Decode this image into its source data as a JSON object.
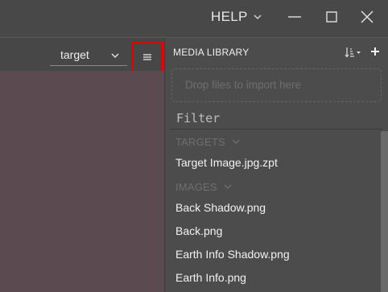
{
  "titlebar": {
    "help_label": "HELP",
    "help_chevron_icon": "chevron-down-icon",
    "minimize_icon": "minimize-icon",
    "maximize_icon": "maximize-icon",
    "close_icon": "close-icon"
  },
  "left_toolbar": {
    "target_select_value": "target",
    "target_select_icon": "chevron-down-icon",
    "menu_icon": "hamburger-menu-icon",
    "menu_highlight_color": "#e60000"
  },
  "canvas": {
    "background_color": "#5b4a4f"
  },
  "media_library": {
    "title": "MEDIA LIBRARY",
    "sort_icon": "sort-icon",
    "add_icon": "plus-icon",
    "drop_zone_text": "Drop files to import here",
    "filter_placeholder": "Filter",
    "sections": [
      {
        "label": "TARGETS",
        "items": [
          "Target Image.jpg.zpt"
        ]
      },
      {
        "label": "IMAGES",
        "items": [
          "Back Shadow.png",
          "Back.png",
          "Earth Info Shadow.png",
          "Earth Info.png"
        ]
      }
    ]
  }
}
